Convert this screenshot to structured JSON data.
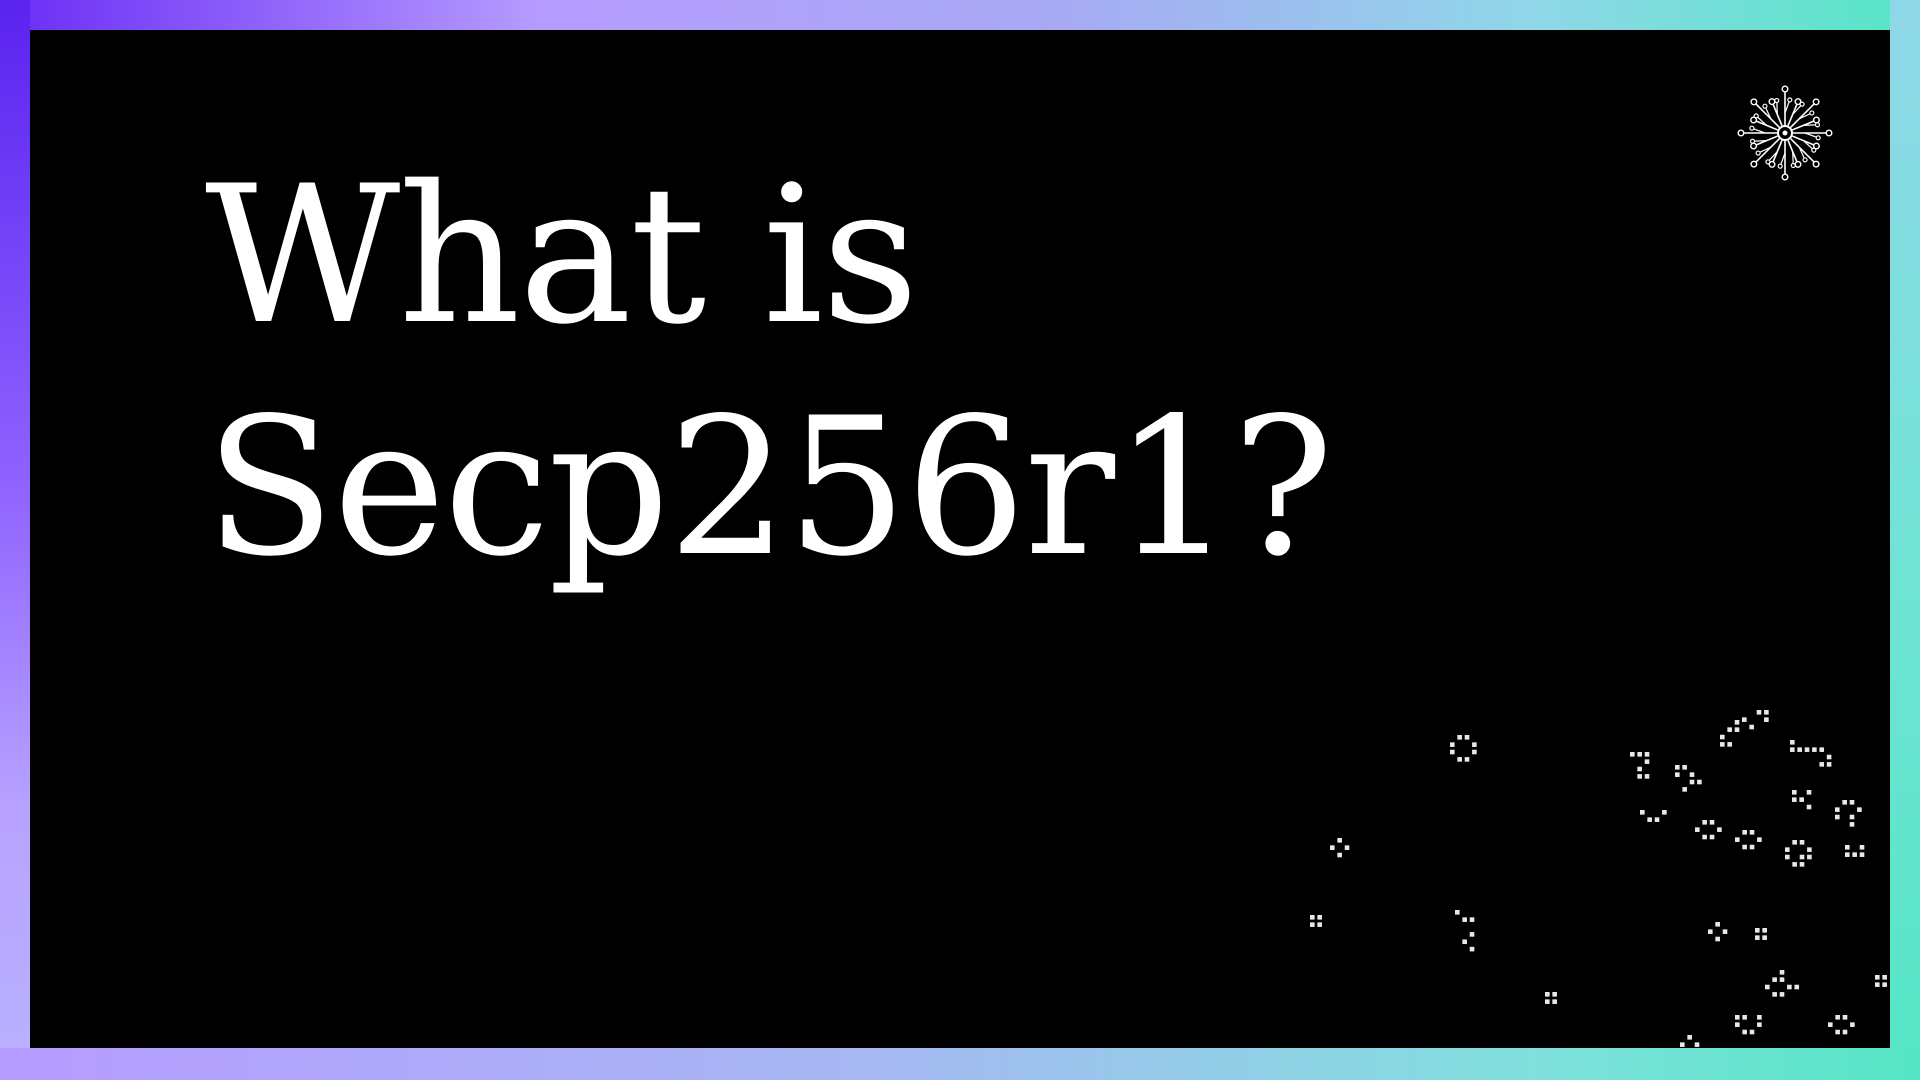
{
  "slide": {
    "title_line1": "What is",
    "title_line2": "Secp256r1?"
  },
  "icons": {
    "logo": "radial-circuit-logo-icon",
    "decoration": "pixel-cluster-decoration"
  },
  "colors": {
    "background": "#000000",
    "text": "#ffffff",
    "frame_start": "#6a2cf5",
    "frame_mid": "#b59bff",
    "frame_end": "#55e6c5"
  }
}
